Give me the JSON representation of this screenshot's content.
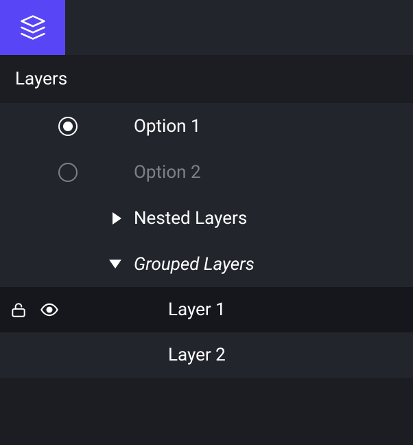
{
  "panel": {
    "title": "Layers"
  },
  "options": [
    {
      "label": "Option 1",
      "selected": true
    },
    {
      "label": "Option 2",
      "selected": false
    }
  ],
  "groups": [
    {
      "label": "Nested Layers",
      "expanded": false,
      "italic": false
    },
    {
      "label": "Grouped Layers",
      "expanded": true,
      "italic": true
    }
  ],
  "layers": [
    {
      "label": "Layer 1",
      "selected": true,
      "locked": false,
      "visible": true
    },
    {
      "label": "Layer 2",
      "selected": false
    }
  ],
  "colors": {
    "accent": "#5846f6",
    "bg": "#1b1d23",
    "panel": "#22252c",
    "selected": "#15171c",
    "dim": "#7d808a"
  }
}
